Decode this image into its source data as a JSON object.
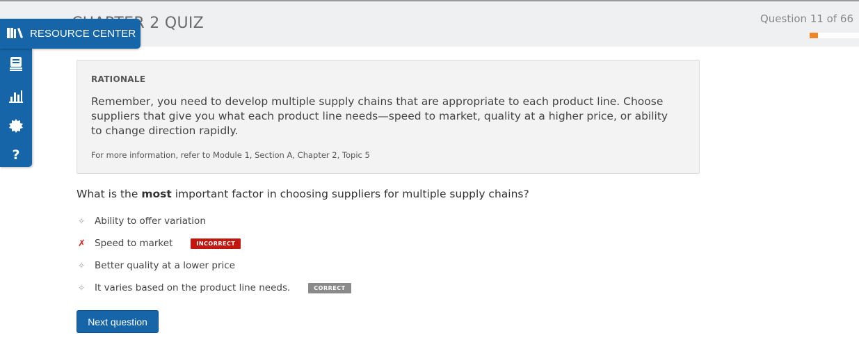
{
  "header": {
    "quiz_title": "CHAPTER 2 QUIZ",
    "question_counter": "Question 11 of 66",
    "progress_fraction": 0.167,
    "progress_color": "#f0852b"
  },
  "resource_center": {
    "label": "RESOURCE CENTER",
    "icons": [
      "books-icon",
      "document-stack-icon",
      "bar-chart-icon",
      "gear-icon",
      "help-icon"
    ],
    "color": "#1565a8"
  },
  "rationale": {
    "heading": "RATIONALE",
    "body": "Remember, you need to develop multiple supply chains that are appropriate to each product line. Choose suppliers that give you what each product line needs—speed to market, quality at a higher price, or ability to change direction rapidly.",
    "reference": "For more information, refer to Module 1, Section A, Chapter 2, Topic 5"
  },
  "question": {
    "prefix": "What is the ",
    "emphasis": "most",
    "suffix": " important factor in choosing suppliers for multiple supply chains?"
  },
  "answers": [
    {
      "text": "Ability to offer variation",
      "marker": "✧",
      "badge": ""
    },
    {
      "text": "Speed to market",
      "marker": "✗",
      "badge": "INCORRECT"
    },
    {
      "text": "Better quality at a lower price",
      "marker": "✧",
      "badge": ""
    },
    {
      "text": "It varies based on the product line needs.",
      "marker": "✧",
      "badge": "CORRECT"
    }
  ],
  "next_button": {
    "label": "Next question"
  }
}
